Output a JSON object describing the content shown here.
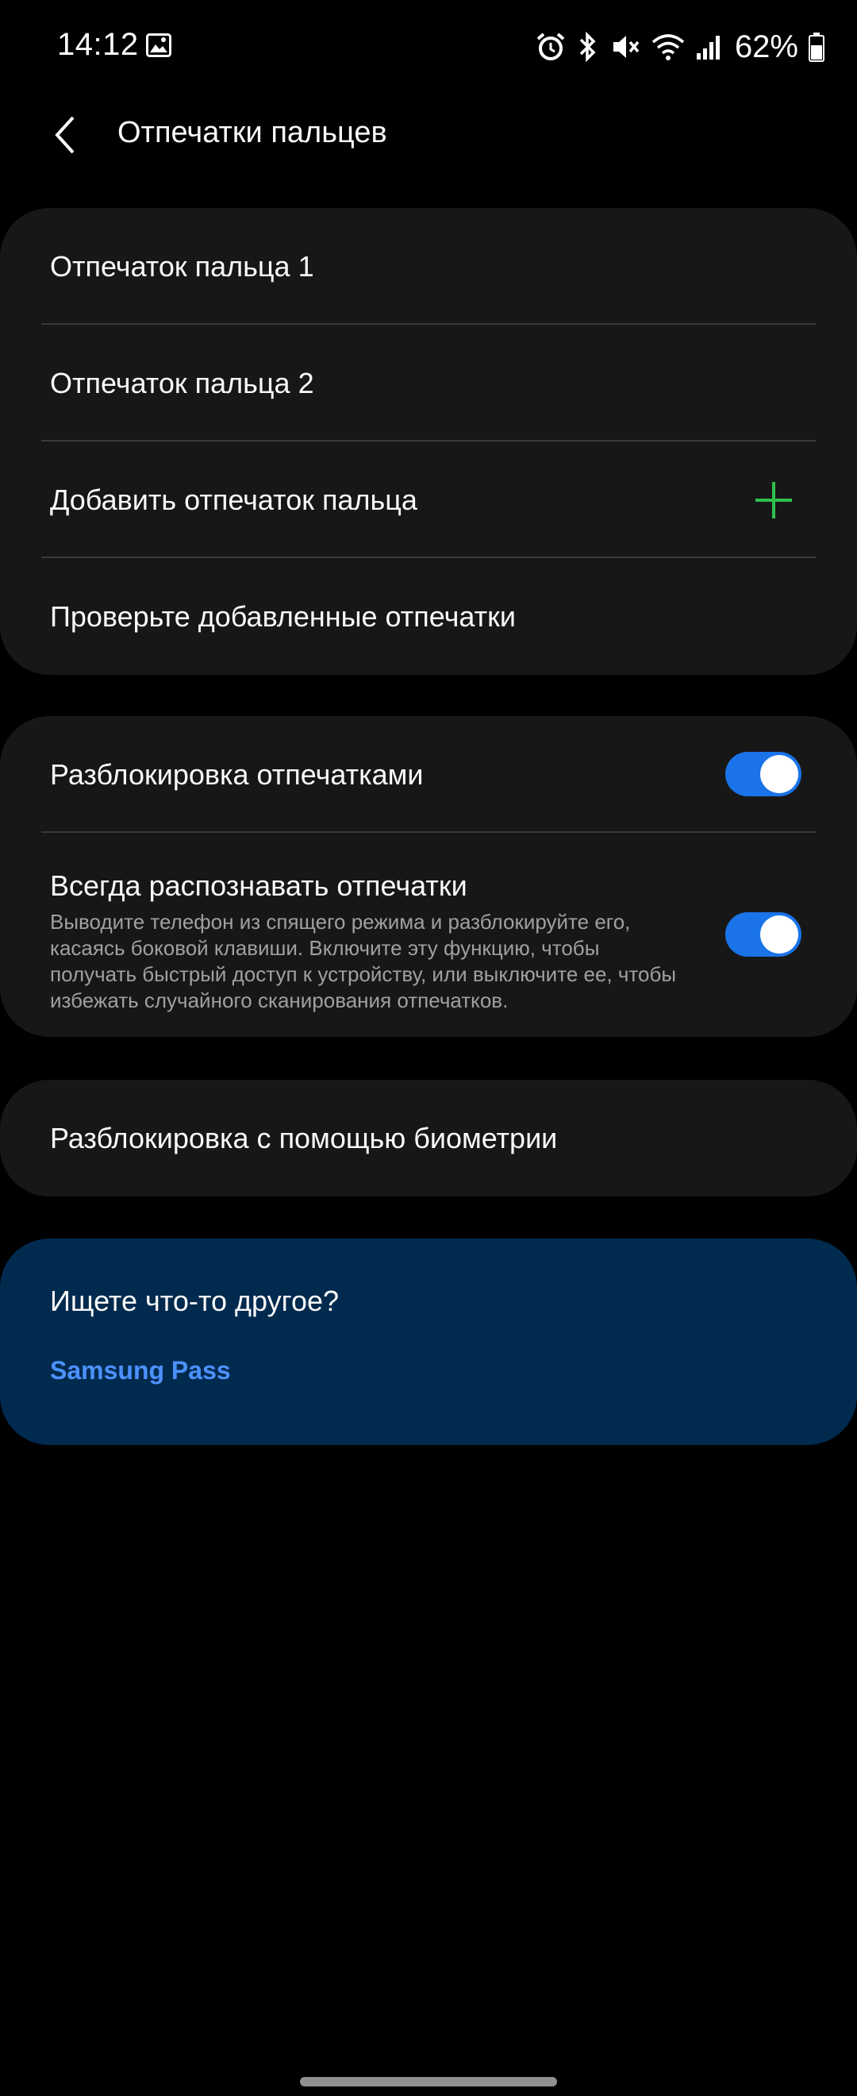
{
  "status_bar": {
    "time": "14:12",
    "battery": "62%",
    "icons": [
      "gallery-icon",
      "alarm-icon",
      "bluetooth-icon",
      "mute-icon",
      "wifi-icon",
      "signal-icon",
      "battery-icon"
    ]
  },
  "header": {
    "title": "Отпечатки пальцев",
    "back_icon": "chevron-left-icon"
  },
  "fingerprints_card": {
    "items": [
      {
        "label": "Отпечаток пальца 1"
      },
      {
        "label": "Отпечаток пальца 2"
      },
      {
        "label": "Добавить отпечаток пальца",
        "icon": "plus-icon"
      },
      {
        "label": "Проверьте добавленные отпечатки"
      }
    ]
  },
  "settings_card": {
    "unlock": {
      "label": "Разблокировка отпечатками",
      "enabled": true
    },
    "always_on": {
      "title": "Всегда распознавать отпечатки",
      "description": "Выводите телефон из спящего режима и разблокируйте его, касаясь боковой клавиши. Включите эту функцию, чтобы получать быстрый доступ к устройству, или выключите ее, чтобы избежать случайного сканирования отпечатков.",
      "enabled": true
    }
  },
  "biometrics_card": {
    "label": "Разблокировка с помощью биометрии"
  },
  "info_card": {
    "title": "Ищете что-то другое?",
    "link": "Samsung Pass"
  },
  "colors": {
    "background": "#000000",
    "card": "#171717",
    "accent_toggle": "#1a73e8",
    "plus": "#2fbf4f",
    "info_card": "#002a4e",
    "link": "#4d91ff"
  }
}
